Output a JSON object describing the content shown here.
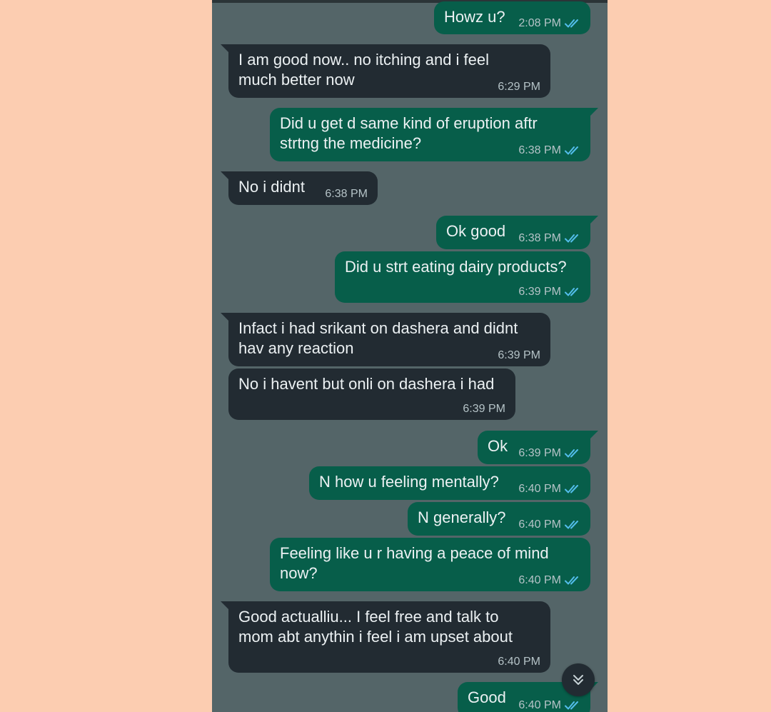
{
  "chat": {
    "messages": [
      {
        "text": "Howz u?",
        "time": "2:08 PM"
      },
      {
        "text": "I am good now.. no itching and i feel\nmuch better now",
        "time": "6:29 PM"
      },
      {
        "text": "Did u get d same kind of eruption aftr\nstrtng the medicine?",
        "time": "6:38 PM"
      },
      {
        "text": "No i didnt",
        "time": "6:38 PM"
      },
      {
        "text": "Ok good",
        "time": "6:38 PM"
      },
      {
        "text": "Did u strt eating dairy products?",
        "time": "6:39 PM"
      },
      {
        "text": "Infact i had srikant on dashera and didnt\nhav any reaction",
        "time": "6:39 PM"
      },
      {
        "text": "No i havent but onli on dashera i had",
        "time": "6:39 PM"
      },
      {
        "text": "Ok",
        "time": "6:39 PM"
      },
      {
        "text": "N how u feeling mentally?",
        "time": "6:40 PM"
      },
      {
        "text": "N generally?",
        "time": "6:40 PM"
      },
      {
        "text": "Feeling like u r having a peace of mind\nnow?",
        "time": "6:40 PM"
      },
      {
        "text": "Good actualliu... I feel free and talk to\nmom abt anythin i feel i am upset about",
        "time": "6:40 PM"
      },
      {
        "text": "Good",
        "time": "6:40 PM"
      }
    ]
  },
  "icons": {
    "read_receipt": "double-check-icon",
    "scroll_down": "chevron-double-down-icon"
  },
  "colors": {
    "background": "#fccdb1",
    "chat_background": "#546568",
    "outgoing_bubble": "#075e4a",
    "incoming_bubble": "#222b32",
    "read_tick": "#53bdeb"
  }
}
